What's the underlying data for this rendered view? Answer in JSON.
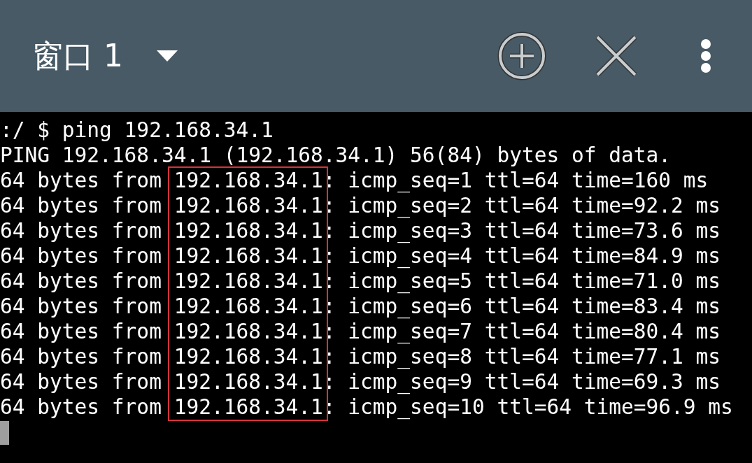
{
  "header": {
    "title": "窗口 1"
  },
  "terminal": {
    "lines": [
      ":/ $ ping 192.168.34.1",
      "PING 192.168.34.1 (192.168.34.1) 56(84) bytes of data."
    ],
    "replies": [
      {
        "prefix": "64 bytes from",
        "address": "192.168.34.1",
        "rest": ": icmp_seq=1 ttl=64 time=160 ms"
      },
      {
        "prefix": "64 bytes from",
        "address": "192.168.34.1",
        "rest": ": icmp_seq=2 ttl=64 time=92.2 ms"
      },
      {
        "prefix": "64 bytes from",
        "address": "192.168.34.1",
        "rest": ": icmp_seq=3 ttl=64 time=73.6 ms"
      },
      {
        "prefix": "64 bytes from",
        "address": "192.168.34.1",
        "rest": ": icmp_seq=4 ttl=64 time=84.9 ms"
      },
      {
        "prefix": "64 bytes from",
        "address": "192.168.34.1",
        "rest": ": icmp_seq=5 ttl=64 time=71.0 ms"
      },
      {
        "prefix": "64 bytes from",
        "address": "192.168.34.1",
        "rest": ": icmp_seq=6 ttl=64 time=83.4 ms"
      },
      {
        "prefix": "64 bytes from",
        "address": "192.168.34.1",
        "rest": ": icmp_seq=7 ttl=64 time=80.4 ms"
      },
      {
        "prefix": "64 bytes from",
        "address": "192.168.34.1",
        "rest": ": icmp_seq=8 ttl=64 time=77.1 ms"
      },
      {
        "prefix": "64 bytes from",
        "address": "192.168.34.1",
        "rest": ": icmp_seq=9 ttl=64 time=69.3 ms"
      },
      {
        "prefix": "64 bytes from",
        "address": "192.168.34.1",
        "rest": ": icmp_seq=10 ttl=64 time=96.9 ms"
      }
    ]
  }
}
